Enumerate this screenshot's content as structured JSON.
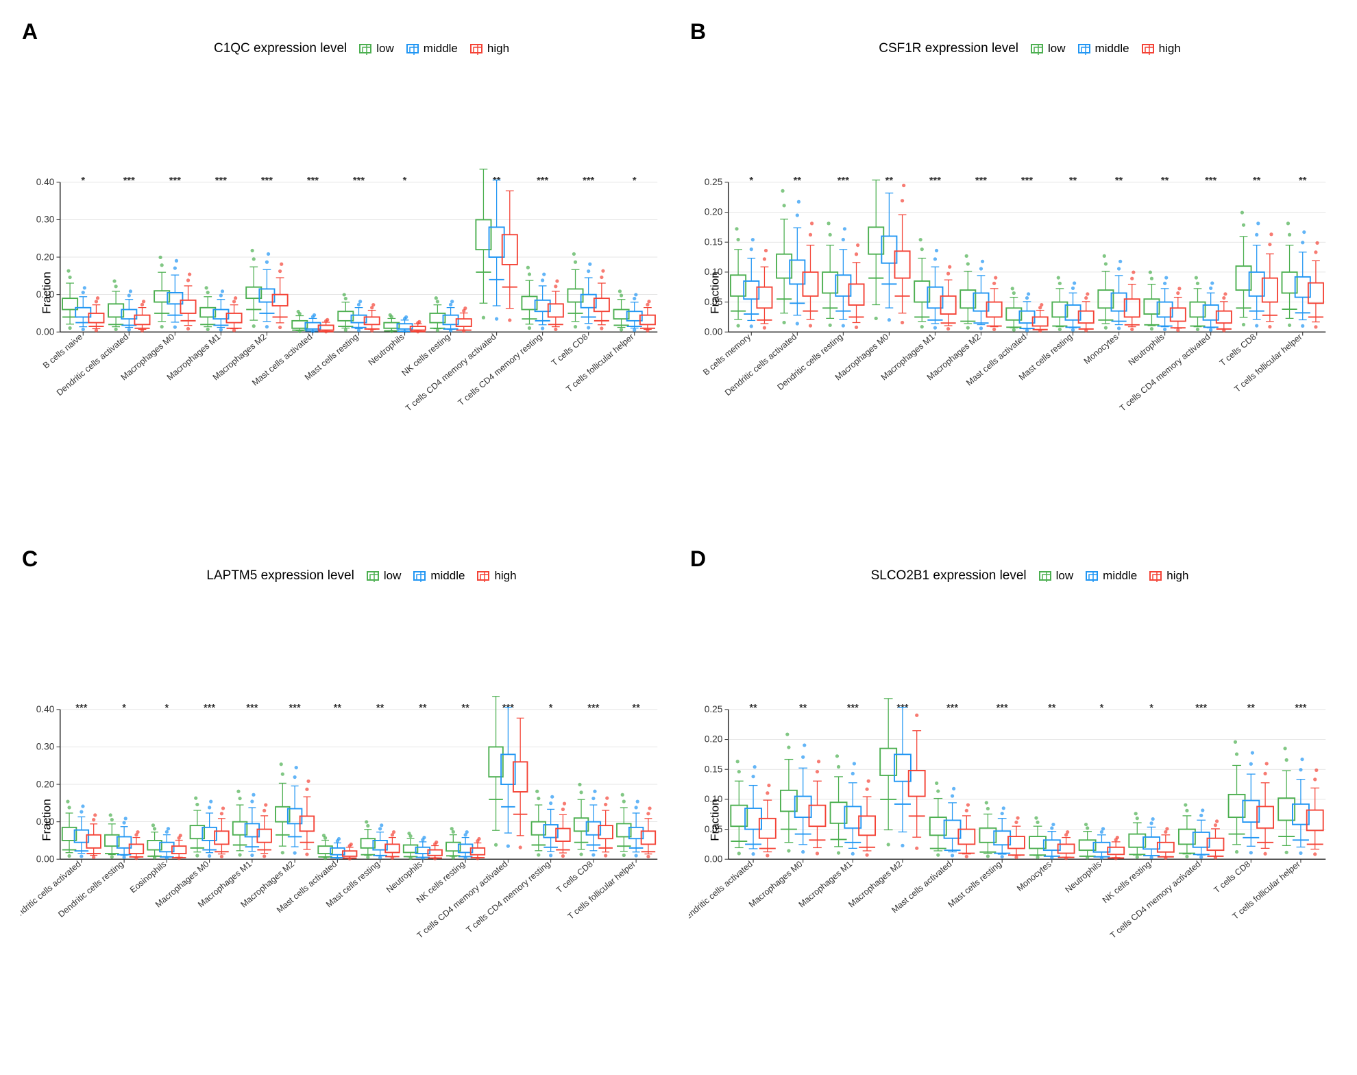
{
  "panels": [
    {
      "label": "A",
      "gene": "C1QC",
      "title": "C1QC expression level",
      "ymax": 0.4,
      "yticks": [
        0,
        0.1,
        0.2,
        0.3,
        0.4
      ],
      "cell_types": [
        "B cells naive",
        "Dendritic cells activated",
        "Macrophages M0",
        "Macrophages M1",
        "Macrophages M2",
        "Mast cells activated",
        "Mast cells resting",
        "Neutrophils",
        "NK cells resting",
        "T cells CD4 memory activated",
        "T cells CD4 memory resting",
        "T cells CD8",
        "T cells follicular helper"
      ],
      "significance": [
        "*",
        "***",
        "***",
        "***",
        "***",
        "***",
        "***",
        "*",
        "",
        "**",
        "***",
        "***",
        "*"
      ],
      "boxes": [
        {
          "low": [
            0.06,
            0.04,
            0.09
          ],
          "mid": [
            0.04,
            0.025,
            0.065
          ],
          "high": [
            0.025,
            0.015,
            0.05
          ]
        },
        {
          "low": [
            0.04,
            0.02,
            0.075
          ],
          "mid": [
            0.035,
            0.018,
            0.06
          ],
          "high": [
            0.02,
            0.01,
            0.045
          ]
        },
        {
          "low": [
            0.08,
            0.05,
            0.11
          ],
          "mid": [
            0.075,
            0.045,
            0.105
          ],
          "high": [
            0.05,
            0.03,
            0.085
          ]
        },
        {
          "low": [
            0.04,
            0.02,
            0.065
          ],
          "mid": [
            0.035,
            0.018,
            0.06
          ],
          "high": [
            0.025,
            0.01,
            0.05
          ]
        },
        {
          "low": [
            0.09,
            0.06,
            0.12
          ],
          "mid": [
            0.08,
            0.05,
            0.115
          ],
          "high": [
            0.07,
            0.04,
            0.1
          ]
        },
        {
          "low": [
            0.01,
            0.005,
            0.03
          ],
          "mid": [
            0.008,
            0.003,
            0.025
          ],
          "high": [
            0.005,
            0.001,
            0.018
          ]
        },
        {
          "low": [
            0.03,
            0.015,
            0.055
          ],
          "mid": [
            0.025,
            0.012,
            0.045
          ],
          "high": [
            0.02,
            0.008,
            0.04
          ]
        },
        {
          "low": [
            0.01,
            0.003,
            0.025
          ],
          "mid": [
            0.008,
            0.002,
            0.022
          ],
          "high": [
            0.005,
            0.001,
            0.015
          ]
        },
        {
          "low": [
            0.025,
            0.01,
            0.05
          ],
          "mid": [
            0.02,
            0.008,
            0.045
          ],
          "high": [
            0.015,
            0.005,
            0.035
          ]
        },
        {
          "low": [
            0.22,
            0.16,
            0.3
          ],
          "mid": [
            0.2,
            0.14,
            0.28
          ],
          "high": [
            0.18,
            0.12,
            0.26
          ]
        },
        {
          "low": [
            0.06,
            0.035,
            0.095
          ],
          "mid": [
            0.055,
            0.03,
            0.085
          ],
          "high": [
            0.04,
            0.02,
            0.075
          ]
        },
        {
          "low": [
            0.08,
            0.05,
            0.115
          ],
          "mid": [
            0.065,
            0.04,
            0.1
          ],
          "high": [
            0.055,
            0.03,
            0.09
          ]
        },
        {
          "low": [
            0.035,
            0.018,
            0.06
          ],
          "mid": [
            0.03,
            0.015,
            0.055
          ],
          "high": [
            0.02,
            0.01,
            0.045
          ]
        }
      ]
    },
    {
      "label": "B",
      "gene": "CSF1R",
      "title": "CSF1R expression level",
      "ymax": 0.25,
      "yticks": [
        0,
        0.05,
        0.1,
        0.15,
        0.2,
        0.25
      ],
      "cell_types": [
        "B cells memory",
        "Dendritic cells activated",
        "Dendritic cells resting",
        "Macrophages M0",
        "Macrophages M1",
        "Macrophages M2",
        "Mast cells activated",
        "Mast cells resting",
        "Monocytes",
        "Neutrophils",
        "T cells CD4 memory activated",
        "T cells CD8",
        "T cells follicular helper"
      ],
      "significance": [
        "*",
        "**",
        "***",
        "**",
        "***",
        "***",
        "***",
        "**",
        "**",
        "**",
        "***",
        "**",
        "**"
      ],
      "boxes": [
        {
          "low": [
            0.06,
            0.035,
            0.095
          ],
          "mid": [
            0.055,
            0.03,
            0.085
          ],
          "high": [
            0.04,
            0.02,
            0.075
          ]
        },
        {
          "low": [
            0.09,
            0.055,
            0.13
          ],
          "mid": [
            0.08,
            0.048,
            0.12
          ],
          "high": [
            0.06,
            0.035,
            0.1
          ]
        },
        {
          "low": [
            0.065,
            0.04,
            0.1
          ],
          "mid": [
            0.06,
            0.035,
            0.095
          ],
          "high": [
            0.045,
            0.025,
            0.08
          ]
        },
        {
          "low": [
            0.13,
            0.09,
            0.175
          ],
          "mid": [
            0.115,
            0.08,
            0.16
          ],
          "high": [
            0.09,
            0.06,
            0.135
          ]
        },
        {
          "low": [
            0.05,
            0.025,
            0.085
          ],
          "mid": [
            0.04,
            0.02,
            0.075
          ],
          "high": [
            0.03,
            0.015,
            0.06
          ]
        },
        {
          "low": [
            0.04,
            0.018,
            0.07
          ],
          "mid": [
            0.035,
            0.015,
            0.065
          ],
          "high": [
            0.025,
            0.01,
            0.05
          ]
        },
        {
          "low": [
            0.02,
            0.008,
            0.04
          ],
          "mid": [
            0.015,
            0.006,
            0.035
          ],
          "high": [
            0.01,
            0.004,
            0.025
          ]
        },
        {
          "low": [
            0.025,
            0.01,
            0.05
          ],
          "mid": [
            0.02,
            0.008,
            0.045
          ],
          "high": [
            0.015,
            0.005,
            0.035
          ]
        },
        {
          "low": [
            0.04,
            0.02,
            0.07
          ],
          "mid": [
            0.035,
            0.018,
            0.065
          ],
          "high": [
            0.025,
            0.012,
            0.055
          ]
        },
        {
          "low": [
            0.03,
            0.012,
            0.055
          ],
          "mid": [
            0.025,
            0.01,
            0.05
          ],
          "high": [
            0.018,
            0.007,
            0.04
          ]
        },
        {
          "low": [
            0.025,
            0.01,
            0.05
          ],
          "mid": [
            0.02,
            0.008,
            0.045
          ],
          "high": [
            0.015,
            0.005,
            0.035
          ]
        },
        {
          "low": [
            0.07,
            0.04,
            0.11
          ],
          "mid": [
            0.06,
            0.035,
            0.1
          ],
          "high": [
            0.05,
            0.028,
            0.09
          ]
        },
        {
          "low": [
            0.065,
            0.038,
            0.1
          ],
          "mid": [
            0.058,
            0.032,
            0.092
          ],
          "high": [
            0.048,
            0.025,
            0.082
          ]
        }
      ]
    },
    {
      "label": "C",
      "gene": "LAPTM5",
      "title": "LAPTM5 expression level",
      "ymax": 0.4,
      "yticks": [
        0,
        0.1,
        0.2,
        0.3,
        0.4
      ],
      "cell_types": [
        "Dendritic cells activated",
        "Dendritic cells resting",
        "Eosinophils",
        "Macrophages M0",
        "Macrophages M1",
        "Macrophages M2",
        "Mast cells activated",
        "Mast cells resting",
        "Neutrophils",
        "NK cells resting",
        "T cells CD4 memory activated",
        "T cells CD4 memory resting",
        "T cells CD8",
        "T cells follicular helper"
      ],
      "significance": [
        "***",
        "*",
        "*",
        "***",
        "***",
        "***",
        "**",
        "**",
        "**",
        "**",
        "***",
        "*",
        "***",
        "**"
      ],
      "boxes": [
        {
          "low": [
            0.05,
            0.025,
            0.085
          ],
          "mid": [
            0.045,
            0.022,
            0.078
          ],
          "high": [
            0.03,
            0.015,
            0.065
          ]
        },
        {
          "low": [
            0.035,
            0.015,
            0.065
          ],
          "mid": [
            0.03,
            0.012,
            0.06
          ],
          "high": [
            0.015,
            0.006,
            0.04
          ]
        },
        {
          "low": [
            0.025,
            0.008,
            0.05
          ],
          "mid": [
            0.02,
            0.006,
            0.045
          ],
          "high": [
            0.015,
            0.004,
            0.035
          ]
        },
        {
          "low": [
            0.055,
            0.03,
            0.09
          ],
          "mid": [
            0.05,
            0.025,
            0.085
          ],
          "high": [
            0.04,
            0.02,
            0.075
          ]
        },
        {
          "low": [
            0.065,
            0.038,
            0.1
          ],
          "mid": [
            0.06,
            0.033,
            0.095
          ],
          "high": [
            0.045,
            0.025,
            0.08
          ]
        },
        {
          "low": [
            0.1,
            0.065,
            0.14
          ],
          "mid": [
            0.095,
            0.06,
            0.135
          ],
          "high": [
            0.075,
            0.045,
            0.115
          ]
        },
        {
          "low": [
            0.015,
            0.006,
            0.035
          ],
          "mid": [
            0.012,
            0.004,
            0.03
          ],
          "high": [
            0.008,
            0.003,
            0.022
          ]
        },
        {
          "low": [
            0.03,
            0.012,
            0.055
          ],
          "mid": [
            0.025,
            0.01,
            0.05
          ],
          "high": [
            0.018,
            0.007,
            0.04
          ]
        },
        {
          "low": [
            0.018,
            0.007,
            0.038
          ],
          "mid": [
            0.015,
            0.005,
            0.032
          ],
          "high": [
            0.01,
            0.003,
            0.025
          ]
        },
        {
          "low": [
            0.022,
            0.009,
            0.045
          ],
          "mid": [
            0.018,
            0.007,
            0.04
          ],
          "high": [
            0.012,
            0.004,
            0.03
          ]
        },
        {
          "low": [
            0.22,
            0.16,
            0.3
          ],
          "mid": [
            0.2,
            0.14,
            0.28
          ],
          "high": [
            0.18,
            0.12,
            0.26
          ]
        },
        {
          "low": [
            0.065,
            0.038,
            0.1
          ],
          "mid": [
            0.058,
            0.032,
            0.092
          ],
          "high": [
            0.048,
            0.025,
            0.082
          ]
        },
        {
          "low": [
            0.075,
            0.045,
            0.11
          ],
          "mid": [
            0.065,
            0.038,
            0.1
          ],
          "high": [
            0.055,
            0.03,
            0.09
          ]
        },
        {
          "low": [
            0.06,
            0.035,
            0.095
          ],
          "mid": [
            0.055,
            0.03,
            0.085
          ],
          "high": [
            0.04,
            0.02,
            0.075
          ]
        }
      ]
    },
    {
      "label": "D",
      "gene": "SLCO2B1",
      "title": "SLCO2B1 expression level",
      "ymax": 0.25,
      "yticks": [
        0,
        0.05,
        0.1,
        0.15,
        0.2,
        0.25
      ],
      "cell_types": [
        "Dendritic cells activated",
        "Macrophages M0",
        "Macrophages M1",
        "Macrophages M2",
        "Mast cells activated",
        "Mast cells resting",
        "Monocytes",
        "Neutrophils",
        "NK cells resting",
        "T cells CD4 memory activated",
        "T cells CD8",
        "T cells follicular helper"
      ],
      "significance": [
        "**",
        "**",
        "***",
        "***",
        "***",
        "***",
        "**",
        "*",
        "*",
        "***",
        "**",
        "***"
      ],
      "boxes": [
        {
          "low": [
            0.055,
            0.03,
            0.09
          ],
          "mid": [
            0.05,
            0.025,
            0.085
          ],
          "high": [
            0.035,
            0.018,
            0.068
          ]
        },
        {
          "low": [
            0.08,
            0.05,
            0.115
          ],
          "mid": [
            0.07,
            0.042,
            0.105
          ],
          "high": [
            0.055,
            0.032,
            0.09
          ]
        },
        {
          "low": [
            0.06,
            0.033,
            0.095
          ],
          "mid": [
            0.052,
            0.028,
            0.088
          ],
          "high": [
            0.04,
            0.02,
            0.072
          ]
        },
        {
          "low": [
            0.14,
            0.1,
            0.185
          ],
          "mid": [
            0.13,
            0.092,
            0.175
          ],
          "high": [
            0.105,
            0.072,
            0.148
          ]
        },
        {
          "low": [
            0.04,
            0.018,
            0.07
          ],
          "mid": [
            0.035,
            0.015,
            0.065
          ],
          "high": [
            0.025,
            0.01,
            0.05
          ]
        },
        {
          "low": [
            0.028,
            0.012,
            0.052
          ],
          "mid": [
            0.024,
            0.01,
            0.047
          ],
          "high": [
            0.018,
            0.007,
            0.038
          ]
        },
        {
          "low": [
            0.018,
            0.007,
            0.038
          ],
          "mid": [
            0.015,
            0.005,
            0.032
          ],
          "high": [
            0.01,
            0.003,
            0.025
          ]
        },
        {
          "low": [
            0.015,
            0.005,
            0.032
          ],
          "mid": [
            0.012,
            0.004,
            0.028
          ],
          "high": [
            0.008,
            0.002,
            0.02
          ]
        },
        {
          "low": [
            0.02,
            0.008,
            0.042
          ],
          "mid": [
            0.017,
            0.006,
            0.037
          ],
          "high": [
            0.012,
            0.004,
            0.028
          ]
        },
        {
          "low": [
            0.025,
            0.01,
            0.05
          ],
          "mid": [
            0.02,
            0.008,
            0.045
          ],
          "high": [
            0.015,
            0.005,
            0.035
          ]
        },
        {
          "low": [
            0.07,
            0.042,
            0.108
          ],
          "mid": [
            0.062,
            0.036,
            0.098
          ],
          "high": [
            0.052,
            0.028,
            0.088
          ]
        },
        {
          "low": [
            0.065,
            0.038,
            0.102
          ],
          "mid": [
            0.058,
            0.032,
            0.092
          ],
          "high": [
            0.048,
            0.025,
            0.082
          ]
        }
      ]
    }
  ],
  "legend": {
    "items": [
      {
        "label": "low",
        "color": "#4CAF50",
        "border": "#4CAF50"
      },
      {
        "label": "middle",
        "color": "#2196F3",
        "border": "#2196F3"
      },
      {
        "label": "high",
        "color": "#F44336",
        "border": "#F44336"
      }
    ]
  },
  "y_axis_label": "Fraction"
}
